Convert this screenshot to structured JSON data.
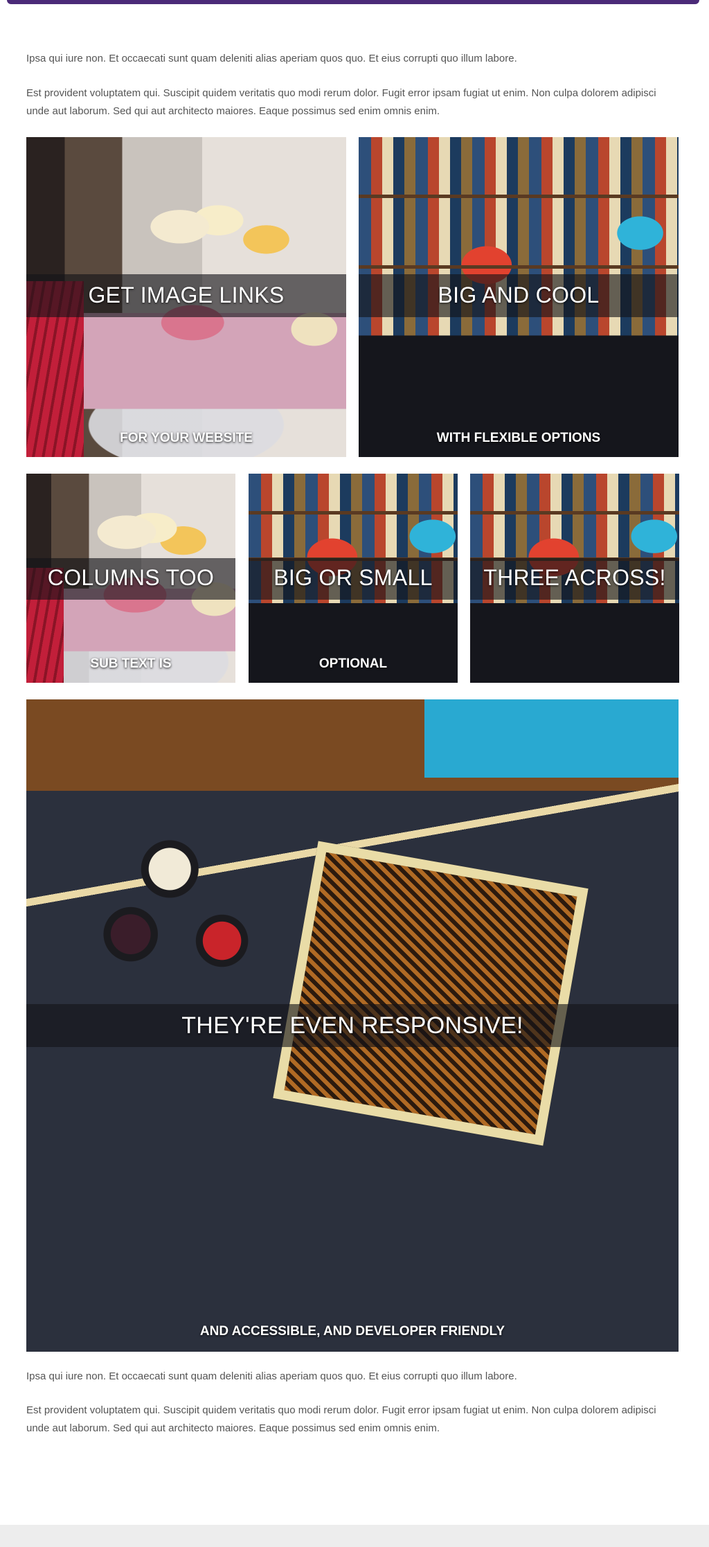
{
  "intro": {
    "p1": "Ipsa qui iure non. Et occaecati sunt quam deleniti alias aperiam quos quo. Et eius corrupti quo illum labore.",
    "p2": "Est provident voluptatem qui. Suscipit quidem veritatis quo modi rerum dolor. Fugit error ipsam fugiat ut enim. Non culpa dolorem adipisci unde aut laborum. Sed qui aut architecto maiores. Eaque possimus sed enim omnis enim."
  },
  "tiles": [
    {
      "heading": "GET IMAGE LINKS",
      "sub": "FOR YOUR WEBSITE",
      "image": "cupcakes-photo"
    },
    {
      "heading": "BIG AND COOL",
      "sub": "WITH FLEXIBLE OPTIONS",
      "image": "bookshelf-table-photo"
    },
    {
      "heading": "COLUMNS TOO",
      "sub": "SUB TEXT IS",
      "image": "cupcakes-photo"
    },
    {
      "heading": "BIG OR SMALL",
      "sub": "OPTIONAL",
      "image": "bookshelf-table-photo"
    },
    {
      "heading": "THREE ACROSS!",
      "sub": "",
      "image": "bookshelf-table-photo"
    },
    {
      "heading": "THEY'RE EVEN RESPONSIVE!",
      "sub": "AND ACCESSIBLE, AND DEVELOPER FRIENDLY",
      "image": "jars-and-card-photo"
    }
  ],
  "outro": {
    "p1": "Ipsa qui iure non. Et occaecati sunt quam deleniti alias aperiam quos quo. Et eius corrupti quo illum labore.",
    "p2": "Est provident voluptatem qui. Suscipit quidem veritatis quo modi rerum dolor. Fugit error ipsam fugiat ut enim. Non culpa dolorem adipisci unde aut laborum. Sed qui aut architecto maiores. Eaque possimus sed enim omnis enim."
  },
  "colors": {
    "brand_bar": "#4b2a78",
    "overlay_band": "rgba(20,20,24,0.62)",
    "text": "#555555",
    "footer": "#ededed"
  }
}
